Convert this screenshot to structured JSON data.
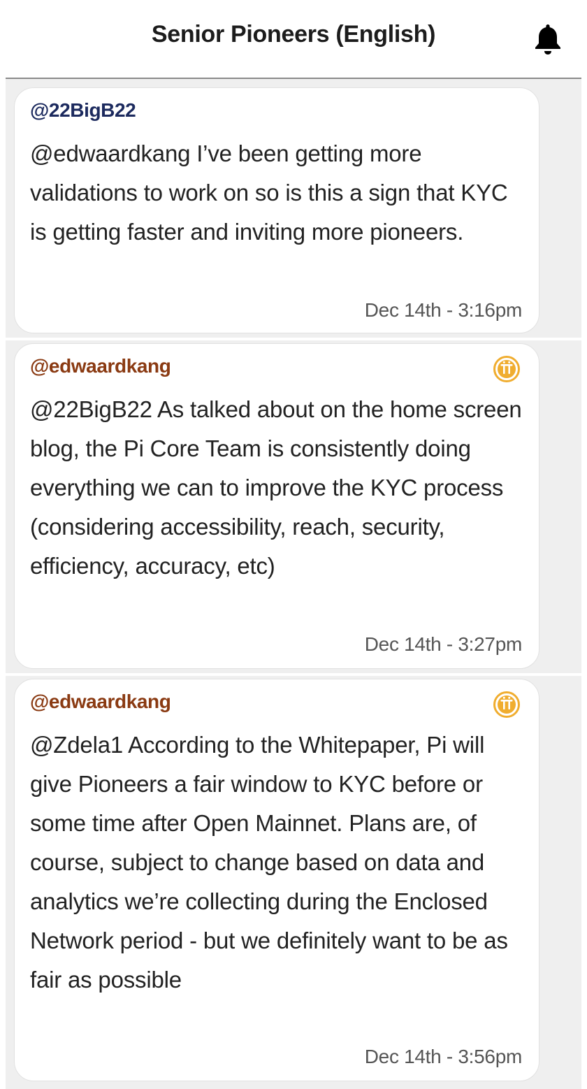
{
  "header": {
    "title": "Senior Pioneers (English)",
    "notification_icon": "bell-icon"
  },
  "colors": {
    "user_name": "#1c2a5e",
    "team_name": "#8a3a12",
    "badge": "#f0ad2f"
  },
  "messages": [
    {
      "author": "@22BigB22",
      "text": "@edwaardkang I’ve been getting more validations to work on so is this a sign that KYC is getting faster and inviting more pioneers.",
      "timestamp": "Dec 14th - 3:16pm",
      "badge": null
    },
    {
      "author": "@edwaardkang",
      "text": "@22BigB22 As talked about on the home screen blog, the Pi Core Team is consistently doing everything we can to improve the KYC process (considering accessibility, reach, security, efficiency, accuracy, etc)",
      "timestamp": "Dec 14th - 3:27pm",
      "badge": "pi-core-team-icon"
    },
    {
      "author": "@edwaardkang",
      "text": "@Zdela1 According to the Whitepaper, Pi will give Pioneers a fair window to KYC before or some time after Open Mainnet. Plans are, of course, subject to change based on data and analytics we’re collecting during the Enclosed Network period - but we definitely want to be as fair as possible",
      "timestamp": "Dec 14th - 3:56pm",
      "badge": "pi-core-team-icon"
    }
  ]
}
